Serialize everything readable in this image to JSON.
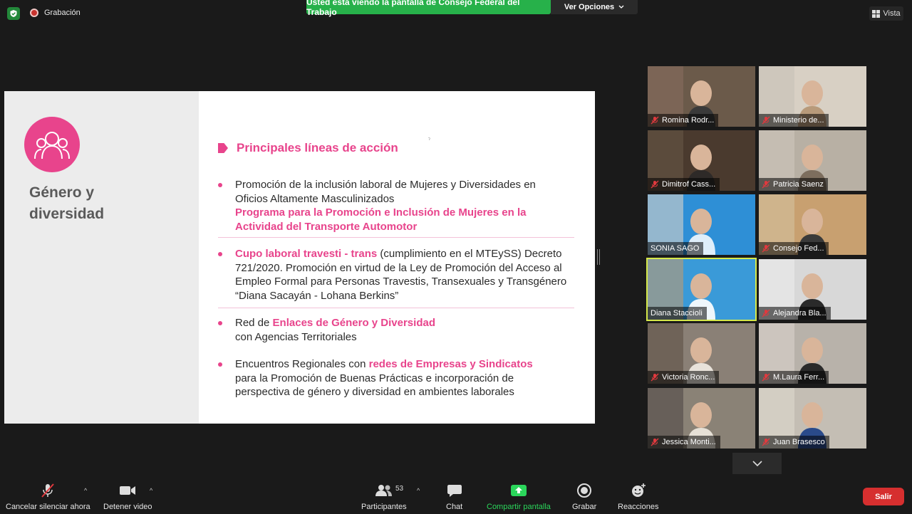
{
  "topbar": {
    "recording_label": "Grabación",
    "share_banner": "Usted está viendo la pantalla de Consejo Federal del Trabajo",
    "view_options": "Ver Opciones",
    "view_label": "Vista"
  },
  "slide": {
    "title": "Género y diversidad",
    "section_heading": "Principales líneas de acción",
    "tiny_mark": "ˀ",
    "b1_line1": "Promoción de la inclusión laboral de Mujeres y Diversidades en Oficios Altamente Masculinizados",
    "b1_highlight": "Programa para la Promoción e Inclusión de Mujeres en la Actividad del Transporte Automotor",
    "b2_highlight": "Cupo laboral travesti - trans",
    "b2_text": " (cumplimiento en el MTEySS) Decreto 721/2020. Promoción en virtud de la Ley de Promoción del Acceso al Empleo Formal para Personas Travestis, Transexuales y Transgénero “Diana Sacayán - Lohana Berkins”",
    "b3_prefix": "Red de ",
    "b3_highlight": "Enlaces de Género y Diversidad",
    "b3_suffix": "con Agencias Territoriales",
    "b4_prefix": "Encuentros Regionales con ",
    "b4_highlight": "redes de Empresas y Sindicatos",
    "b4_suffix": "para la Promoción de Buenas Prácticas e incorporación de perspectiva de género y diversidad en ambientes laborales",
    "accent_color": "#e8448c"
  },
  "participants": [
    {
      "name": "Romina Rodr...",
      "muted": true
    },
    {
      "name": "Ministerio de...",
      "muted": true
    },
    {
      "name": "Dimitrof Cass...",
      "muted": true
    },
    {
      "name": "Patricia Saenz",
      "muted": true
    },
    {
      "name": "SONIA SAGO",
      "muted": false
    },
    {
      "name": "Consejo Fed...",
      "muted": true
    },
    {
      "name": "Diana Staccioli",
      "muted": false,
      "active_speaker": true
    },
    {
      "name": "Alejandra Bla...",
      "muted": true
    },
    {
      "name": "Victoria Ronc...",
      "muted": true
    },
    {
      "name": "M.Laura Ferr...",
      "muted": true
    },
    {
      "name": "Jessica Monti...",
      "muted": true
    },
    {
      "name": "Juan Brasesco",
      "muted": true
    }
  ],
  "toolbar": {
    "unmute_label": "Cancelar silenciar ahora",
    "video_label": "Detener video",
    "participants_label": "Participantes",
    "participants_count": "53",
    "chat_label": "Chat",
    "share_label": "Compartir pantalla",
    "record_label": "Grabar",
    "reactions_label": "Reacciones",
    "leave_label": "Salir",
    "share_color": "#2bd65b",
    "leave_color": "#d62f2f"
  }
}
